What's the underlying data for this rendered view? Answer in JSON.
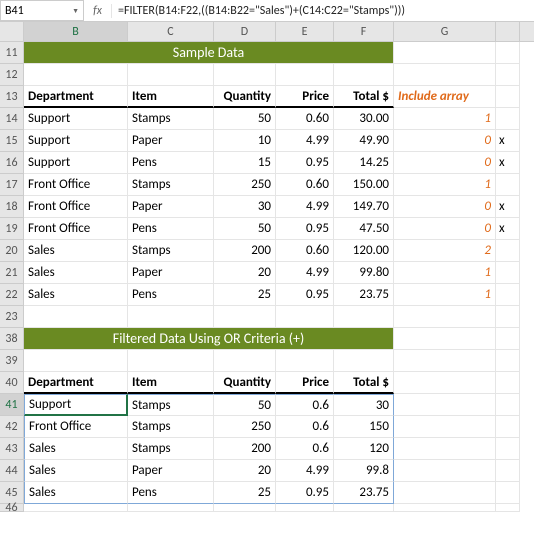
{
  "name_box": "B41",
  "formula": "=FILTER(B14:F22,((B14:B22=\"Sales\")+(C14:C22=\"Stamps\")))",
  "cols": [
    "B",
    "C",
    "D",
    "E",
    "F",
    "G"
  ],
  "extra_col": "",
  "rows_top": [
    "11",
    "12",
    "13",
    "14",
    "15",
    "16",
    "17",
    "18",
    "19",
    "20",
    "21",
    "22",
    "23"
  ],
  "rows_bot": [
    "38",
    "39",
    "40",
    "41",
    "42",
    "43",
    "44",
    "45",
    "46"
  ],
  "banner1": "Sample Data",
  "banner2": "Filtered Data Using OR Criteria (+)",
  "headers": {
    "dept": "Department",
    "item": "Item",
    "qty": "Quantity",
    "price": "Price",
    "total": "Total $",
    "inc": "Include array"
  },
  "d": [
    {
      "dept": "Support",
      "item": "Stamps",
      "q": "50",
      "p": "0.60",
      "t": "30.00",
      "a": "1",
      "x": ""
    },
    {
      "dept": "Support",
      "item": "Paper",
      "q": "10",
      "p": "4.99",
      "t": "49.90",
      "a": "0",
      "x": "x"
    },
    {
      "dept": "Support",
      "item": "Pens",
      "q": "15",
      "p": "0.95",
      "t": "14.25",
      "a": "0",
      "x": "x"
    },
    {
      "dept": "Front Office",
      "item": "Stamps",
      "q": "250",
      "p": "0.60",
      "t": "150.00",
      "a": "1",
      "x": ""
    },
    {
      "dept": "Front Office",
      "item": "Paper",
      "q": "30",
      "p": "4.99",
      "t": "149.70",
      "a": "0",
      "x": "x"
    },
    {
      "dept": "Front Office",
      "item": "Pens",
      "q": "50",
      "p": "0.95",
      "t": "47.50",
      "a": "0",
      "x": "x"
    },
    {
      "dept": "Sales",
      "item": "Stamps",
      "q": "200",
      "p": "0.60",
      "t": "120.00",
      "a": "2",
      "x": ""
    },
    {
      "dept": "Sales",
      "item": "Paper",
      "q": "20",
      "p": "4.99",
      "t": "99.80",
      "a": "1",
      "x": ""
    },
    {
      "dept": "Sales",
      "item": "Pens",
      "q": "25",
      "p": "0.95",
      "t": "23.75",
      "a": "1",
      "x": ""
    }
  ],
  "f": [
    {
      "dept": "Support",
      "item": "Stamps",
      "q": "50",
      "p": "0.6",
      "t": "30"
    },
    {
      "dept": "Front Office",
      "item": "Stamps",
      "q": "250",
      "p": "0.6",
      "t": "150"
    },
    {
      "dept": "Sales",
      "item": "Stamps",
      "q": "200",
      "p": "0.6",
      "t": "120"
    },
    {
      "dept": "Sales",
      "item": "Paper",
      "q": "20",
      "p": "4.99",
      "t": "99.8"
    },
    {
      "dept": "Sales",
      "item": "Pens",
      "q": "25",
      "p": "0.95",
      "t": "23.75"
    }
  ],
  "chart_data": {
    "type": "table",
    "title": "Sample Data",
    "columns": [
      "Department",
      "Item",
      "Quantity",
      "Price",
      "Total $",
      "Include array"
    ],
    "rows": [
      [
        "Support",
        "Stamps",
        50,
        0.6,
        30.0,
        1
      ],
      [
        "Support",
        "Paper",
        10,
        4.99,
        49.9,
        0
      ],
      [
        "Support",
        "Pens",
        15,
        0.95,
        14.25,
        0
      ],
      [
        "Front Office",
        "Stamps",
        250,
        0.6,
        150.0,
        1
      ],
      [
        "Front Office",
        "Paper",
        30,
        4.99,
        149.7,
        0
      ],
      [
        "Front Office",
        "Pens",
        50,
        0.95,
        47.5,
        0
      ],
      [
        "Sales",
        "Stamps",
        200,
        0.6,
        120.0,
        2
      ],
      [
        "Sales",
        "Paper",
        20,
        4.99,
        99.8,
        1
      ],
      [
        "Sales",
        "Pens",
        25,
        0.95,
        23.75,
        1
      ]
    ]
  }
}
